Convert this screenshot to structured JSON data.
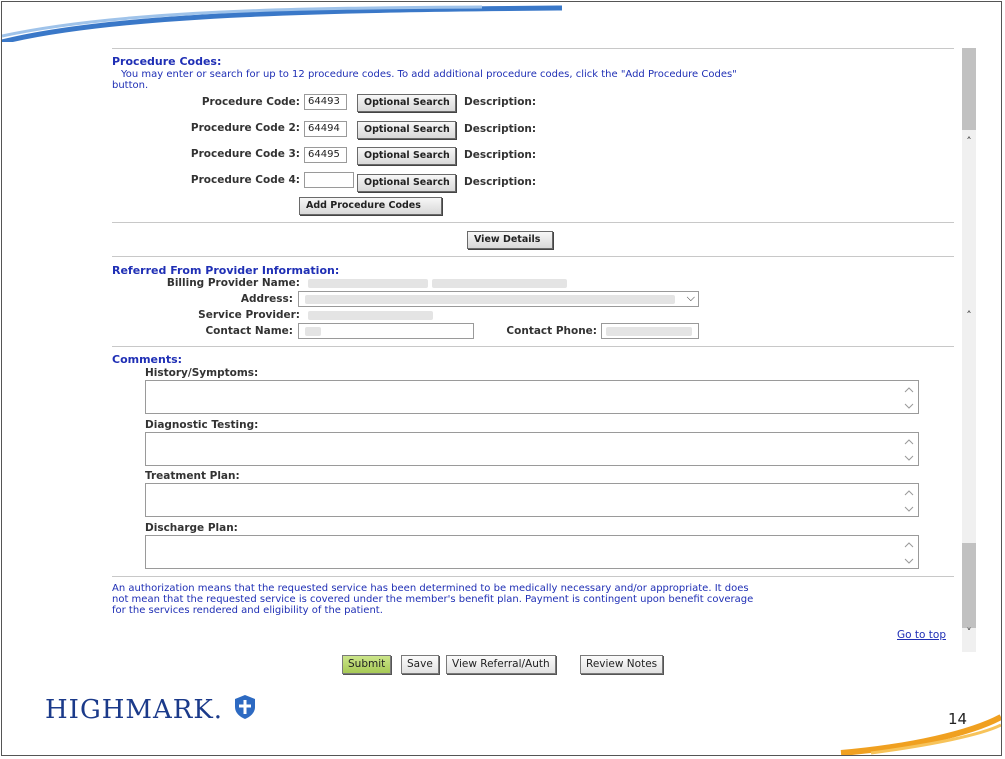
{
  "procedure_section": {
    "title": "Procedure Codes:",
    "instructions": "You may enter or search for up to 12 procedure codes. To add additional procedure codes, click the \"Add Procedure Codes\"",
    "instructions_cont": "button.",
    "rows": [
      {
        "label": "Procedure Code:",
        "value": "64493",
        "search_label": "Optional Search",
        "desc_label": "Description:"
      },
      {
        "label": "Procedure Code 2:",
        "value": "64494",
        "search_label": "Optional Search",
        "desc_label": "Description:"
      },
      {
        "label": "Procedure Code 3:",
        "value": "64495",
        "search_label": "Optional Search",
        "desc_label": "Description:"
      },
      {
        "label": "Procedure Code 4:",
        "value": "",
        "search_label": "Optional Search",
        "desc_label": "Description:"
      }
    ],
    "add_label": "Add Procedure Codes",
    "view_details_label": "View Details"
  },
  "referred_section": {
    "title": "Referred From Provider Information:",
    "billing_provider_label": "Billing Provider Name:",
    "address_label": "Address:",
    "service_provider_label": "Service Provider:",
    "contact_name_label": "Contact Name:",
    "contact_phone_label": "Contact Phone:"
  },
  "comments_section": {
    "title": "Comments:",
    "history_label": "History/Symptoms:",
    "diagnostic_label": "Diagnostic Testing:",
    "treatment_label": "Treatment Plan:",
    "discharge_label": "Discharge Plan:"
  },
  "disclaimer": {
    "line1": "An authorization means that the requested service has been determined to be medically necessary and/or appropriate. It does",
    "line2": "not mean that the requested service is covered under the member's benefit plan. Payment is contingent upon benefit coverage",
    "line3": "for the services rendered and eligibility of the patient."
  },
  "go_to_top_label": "Go to top",
  "footer_buttons": {
    "submit": "Submit",
    "save": "Save",
    "view_referral": "View Referral/Auth",
    "review_notes": "Review Notes"
  },
  "logo_text": "HIGHMARK.",
  "slide_number": "14",
  "colors": {
    "section_title": "#1f2fb5",
    "submit_bg": "#b8d86a",
    "logo": "#1b3a8a",
    "swoosh_orange": "#f0a020"
  }
}
